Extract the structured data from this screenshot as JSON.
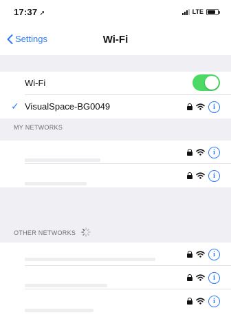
{
  "status_bar": {
    "time": "17:37",
    "location_glyph": "➚",
    "network": "LTE"
  },
  "nav": {
    "back_label": "Settings",
    "title": "Wi-Fi"
  },
  "wifi_row": {
    "label": "Wi-Fi",
    "toggle_on": true,
    "toggle_color": "#4cd964"
  },
  "connected": {
    "name": "VisualSpace-BG0049",
    "check": "✓"
  },
  "my_networks": {
    "header": "MY NETWORKS",
    "count": 2
  },
  "other_networks": {
    "header": "OTHER NETWORKS",
    "count": 3
  },
  "info_glyph": "i",
  "colors": {
    "accent": "#2f7bf5",
    "background": "#efeff4"
  }
}
